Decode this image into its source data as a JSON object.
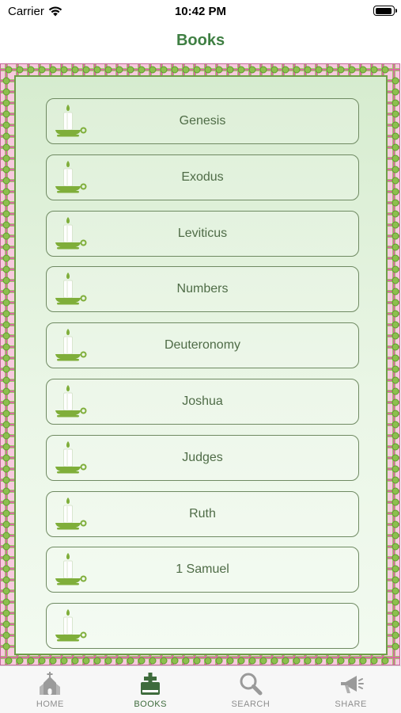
{
  "status_bar": {
    "carrier": "Carrier",
    "time": "10:42 PM"
  },
  "nav": {
    "title": "Books"
  },
  "books": [
    {
      "label": "Genesis"
    },
    {
      "label": "Exodus"
    },
    {
      "label": "Leviticus"
    },
    {
      "label": "Numbers"
    },
    {
      "label": "Deuteronomy"
    },
    {
      "label": "Joshua"
    },
    {
      "label": "Judges"
    },
    {
      "label": "Ruth"
    },
    {
      "label": "1 Samuel"
    },
    {
      "label": ""
    }
  ],
  "book_icon": "candle-icon",
  "tabs": [
    {
      "label": "HOME",
      "icon": "church-icon",
      "active": false
    },
    {
      "label": "BOOKS",
      "icon": "bible-icon",
      "active": true
    },
    {
      "label": "SEARCH",
      "icon": "magnifier-icon",
      "active": false
    },
    {
      "label": "SHARE",
      "icon": "megaphone-icon",
      "active": false
    }
  ],
  "colors": {
    "accent": "#3f7f43",
    "frame_pink": "#f7c9de",
    "frame_green": "#7ab648",
    "text": "#4f6c47",
    "tab_inactive": "#8e8e8e",
    "tab_active": "#3e6b3c"
  }
}
